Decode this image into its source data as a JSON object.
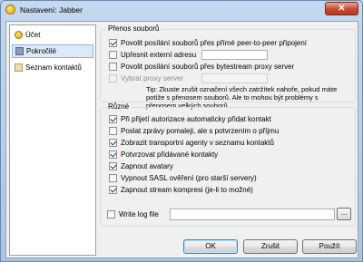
{
  "window": {
    "title": "Nastavení: Jabber",
    "close_glyph": "✕"
  },
  "sidebar": {
    "items": [
      {
        "label": "Účet",
        "icon": "user-icon"
      },
      {
        "label": "Pokročilé",
        "icon": "advanced-icon",
        "active": true
      },
      {
        "label": "Seznam kontaktů",
        "icon": "contacts-icon"
      }
    ]
  },
  "file_transfer": {
    "title": "Přenos souborů",
    "allow_p2p": {
      "label": "Povolit posílání souborů přes přímé peer-to-peer připojení",
      "checked": true
    },
    "external_address": {
      "label": "Upřesnit externí adresu",
      "checked": false,
      "value": ""
    },
    "allow_proxy": {
      "label": "Povolit posílání souborů přes bytestream proxy server",
      "checked": false
    },
    "select_proxy": {
      "label": "Vybrat proxy server",
      "checked": false,
      "disabled": true,
      "value": ""
    },
    "tip": "Tip:  Zkuste zrušit označení všech zatržítek nahoře, pokud máte potíže s přenosem souborů. Ale to mohou být problémy s přenosem velkých souborů."
  },
  "misc": {
    "title": "Různé",
    "options": [
      {
        "label": "Při přijetí autorizace automaticky přidat kontakt",
        "checked": true
      },
      {
        "label": "Poslat zprávy pomaleji, ale s potvrzením o příjmu",
        "checked": false
      },
      {
        "label": "Zobrazit transportní agenty v seznamu kontaktů",
        "checked": true
      },
      {
        "label": "Potvrzovat přidávané kontakty",
        "checked": true
      },
      {
        "label": "Zapnout avatary",
        "checked": true
      },
      {
        "label": "Vypnout SASL ověření (pro starší servery)",
        "checked": false
      },
      {
        "label": "Zapnout stream kompresi (je-li to možné)",
        "checked": true
      }
    ]
  },
  "write_log": {
    "label": "Write log file",
    "checked": false,
    "value": "",
    "browse_label": "..."
  },
  "buttons": {
    "ok": "OK",
    "cancel": "Zrušit",
    "apply": "Použít"
  }
}
